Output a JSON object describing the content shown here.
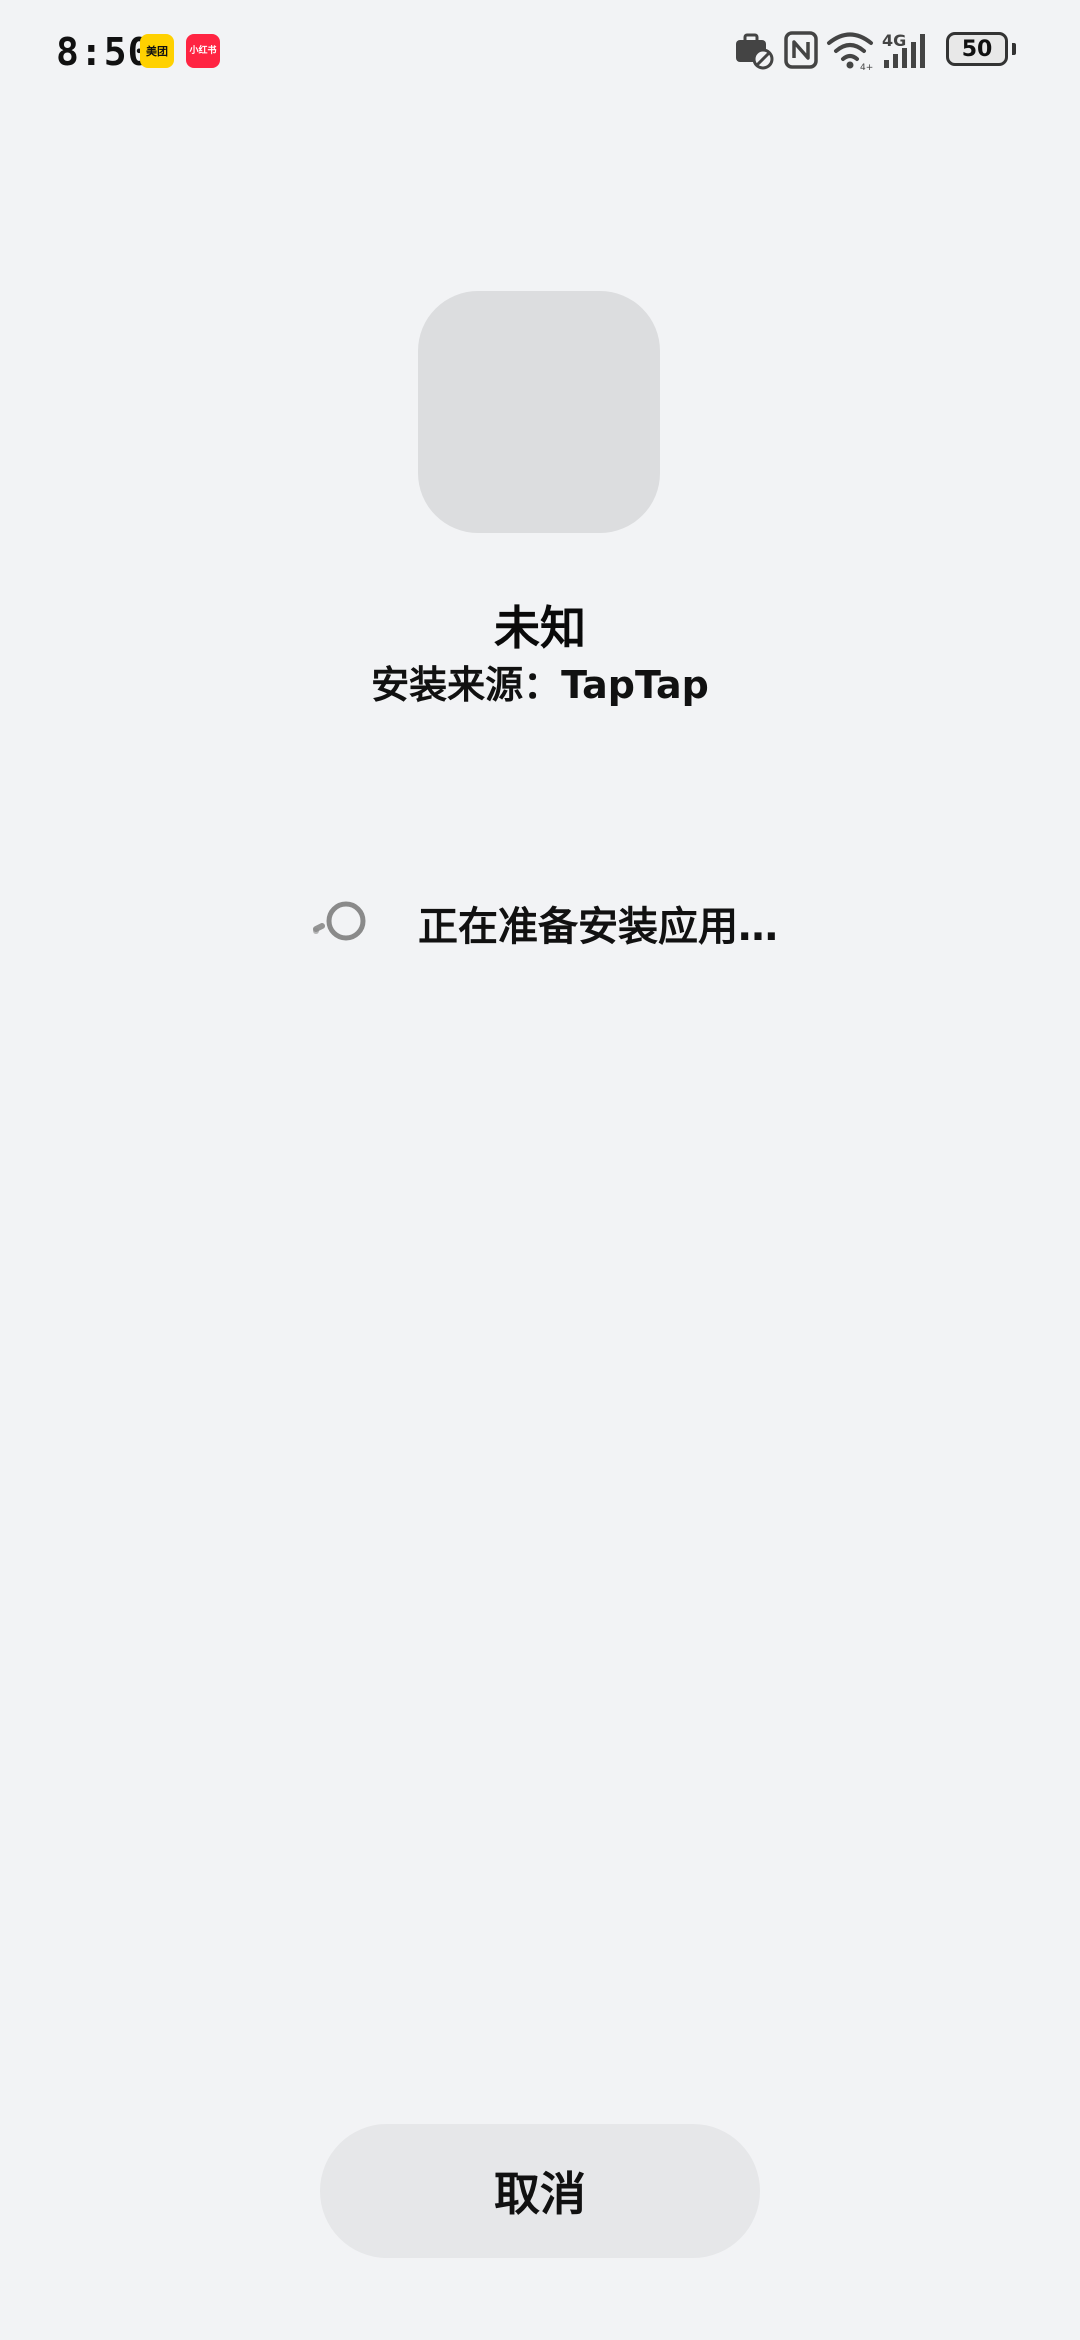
{
  "status_bar": {
    "time": "8:50",
    "notification_apps": [
      {
        "name": "美团",
        "icon": "meituan-app-icon",
        "color": "#ffd100"
      },
      {
        "name": "小红书",
        "icon": "xiaohongshu-app-icon",
        "color": "#ff2442"
      }
    ],
    "system_icons": [
      "briefcase-blocked-icon",
      "nfc-icon",
      "wifi-icon",
      "4g-signal-icon",
      "battery-icon"
    ],
    "network_label": "4G",
    "battery_level": "50"
  },
  "app": {
    "name": "未知",
    "install_source": "安装来源：TapTap"
  },
  "progress": {
    "icon": "loading-spinner-icon",
    "text": "正在准备安装应用…"
  },
  "actions": {
    "cancel_label": "取消"
  },
  "colors": {
    "background": "#f2f3f5",
    "placeholder": "#dcdddf",
    "button": "#e6e7e9",
    "spinner": "#8a8a8a"
  }
}
